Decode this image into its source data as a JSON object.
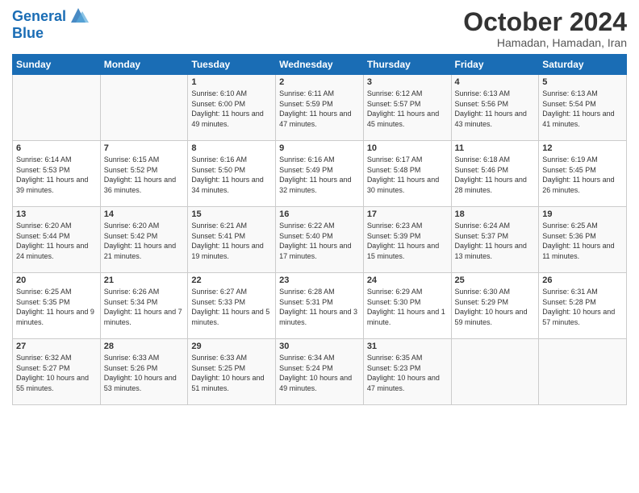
{
  "logo": {
    "line1": "General",
    "line2": "Blue"
  },
  "title": "October 2024",
  "location": "Hamadan, Hamadan, Iran",
  "weekdays": [
    "Sunday",
    "Monday",
    "Tuesday",
    "Wednesday",
    "Thursday",
    "Friday",
    "Saturday"
  ],
  "weeks": [
    [
      {
        "day": "",
        "info": ""
      },
      {
        "day": "",
        "info": ""
      },
      {
        "day": "1",
        "info": "Sunrise: 6:10 AM\nSunset: 6:00 PM\nDaylight: 11 hours and 49 minutes."
      },
      {
        "day": "2",
        "info": "Sunrise: 6:11 AM\nSunset: 5:59 PM\nDaylight: 11 hours and 47 minutes."
      },
      {
        "day": "3",
        "info": "Sunrise: 6:12 AM\nSunset: 5:57 PM\nDaylight: 11 hours and 45 minutes."
      },
      {
        "day": "4",
        "info": "Sunrise: 6:13 AM\nSunset: 5:56 PM\nDaylight: 11 hours and 43 minutes."
      },
      {
        "day": "5",
        "info": "Sunrise: 6:13 AM\nSunset: 5:54 PM\nDaylight: 11 hours and 41 minutes."
      }
    ],
    [
      {
        "day": "6",
        "info": "Sunrise: 6:14 AM\nSunset: 5:53 PM\nDaylight: 11 hours and 39 minutes."
      },
      {
        "day": "7",
        "info": "Sunrise: 6:15 AM\nSunset: 5:52 PM\nDaylight: 11 hours and 36 minutes."
      },
      {
        "day": "8",
        "info": "Sunrise: 6:16 AM\nSunset: 5:50 PM\nDaylight: 11 hours and 34 minutes."
      },
      {
        "day": "9",
        "info": "Sunrise: 6:16 AM\nSunset: 5:49 PM\nDaylight: 11 hours and 32 minutes."
      },
      {
        "day": "10",
        "info": "Sunrise: 6:17 AM\nSunset: 5:48 PM\nDaylight: 11 hours and 30 minutes."
      },
      {
        "day": "11",
        "info": "Sunrise: 6:18 AM\nSunset: 5:46 PM\nDaylight: 11 hours and 28 minutes."
      },
      {
        "day": "12",
        "info": "Sunrise: 6:19 AM\nSunset: 5:45 PM\nDaylight: 11 hours and 26 minutes."
      }
    ],
    [
      {
        "day": "13",
        "info": "Sunrise: 6:20 AM\nSunset: 5:44 PM\nDaylight: 11 hours and 24 minutes."
      },
      {
        "day": "14",
        "info": "Sunrise: 6:20 AM\nSunset: 5:42 PM\nDaylight: 11 hours and 21 minutes."
      },
      {
        "day": "15",
        "info": "Sunrise: 6:21 AM\nSunset: 5:41 PM\nDaylight: 11 hours and 19 minutes."
      },
      {
        "day": "16",
        "info": "Sunrise: 6:22 AM\nSunset: 5:40 PM\nDaylight: 11 hours and 17 minutes."
      },
      {
        "day": "17",
        "info": "Sunrise: 6:23 AM\nSunset: 5:39 PM\nDaylight: 11 hours and 15 minutes."
      },
      {
        "day": "18",
        "info": "Sunrise: 6:24 AM\nSunset: 5:37 PM\nDaylight: 11 hours and 13 minutes."
      },
      {
        "day": "19",
        "info": "Sunrise: 6:25 AM\nSunset: 5:36 PM\nDaylight: 11 hours and 11 minutes."
      }
    ],
    [
      {
        "day": "20",
        "info": "Sunrise: 6:25 AM\nSunset: 5:35 PM\nDaylight: 11 hours and 9 minutes."
      },
      {
        "day": "21",
        "info": "Sunrise: 6:26 AM\nSunset: 5:34 PM\nDaylight: 11 hours and 7 minutes."
      },
      {
        "day": "22",
        "info": "Sunrise: 6:27 AM\nSunset: 5:33 PM\nDaylight: 11 hours and 5 minutes."
      },
      {
        "day": "23",
        "info": "Sunrise: 6:28 AM\nSunset: 5:31 PM\nDaylight: 11 hours and 3 minutes."
      },
      {
        "day": "24",
        "info": "Sunrise: 6:29 AM\nSunset: 5:30 PM\nDaylight: 11 hours and 1 minute."
      },
      {
        "day": "25",
        "info": "Sunrise: 6:30 AM\nSunset: 5:29 PM\nDaylight: 10 hours and 59 minutes."
      },
      {
        "day": "26",
        "info": "Sunrise: 6:31 AM\nSunset: 5:28 PM\nDaylight: 10 hours and 57 minutes."
      }
    ],
    [
      {
        "day": "27",
        "info": "Sunrise: 6:32 AM\nSunset: 5:27 PM\nDaylight: 10 hours and 55 minutes."
      },
      {
        "day": "28",
        "info": "Sunrise: 6:33 AM\nSunset: 5:26 PM\nDaylight: 10 hours and 53 minutes."
      },
      {
        "day": "29",
        "info": "Sunrise: 6:33 AM\nSunset: 5:25 PM\nDaylight: 10 hours and 51 minutes."
      },
      {
        "day": "30",
        "info": "Sunrise: 6:34 AM\nSunset: 5:24 PM\nDaylight: 10 hours and 49 minutes."
      },
      {
        "day": "31",
        "info": "Sunrise: 6:35 AM\nSunset: 5:23 PM\nDaylight: 10 hours and 47 minutes."
      },
      {
        "day": "",
        "info": ""
      },
      {
        "day": "",
        "info": ""
      }
    ]
  ]
}
